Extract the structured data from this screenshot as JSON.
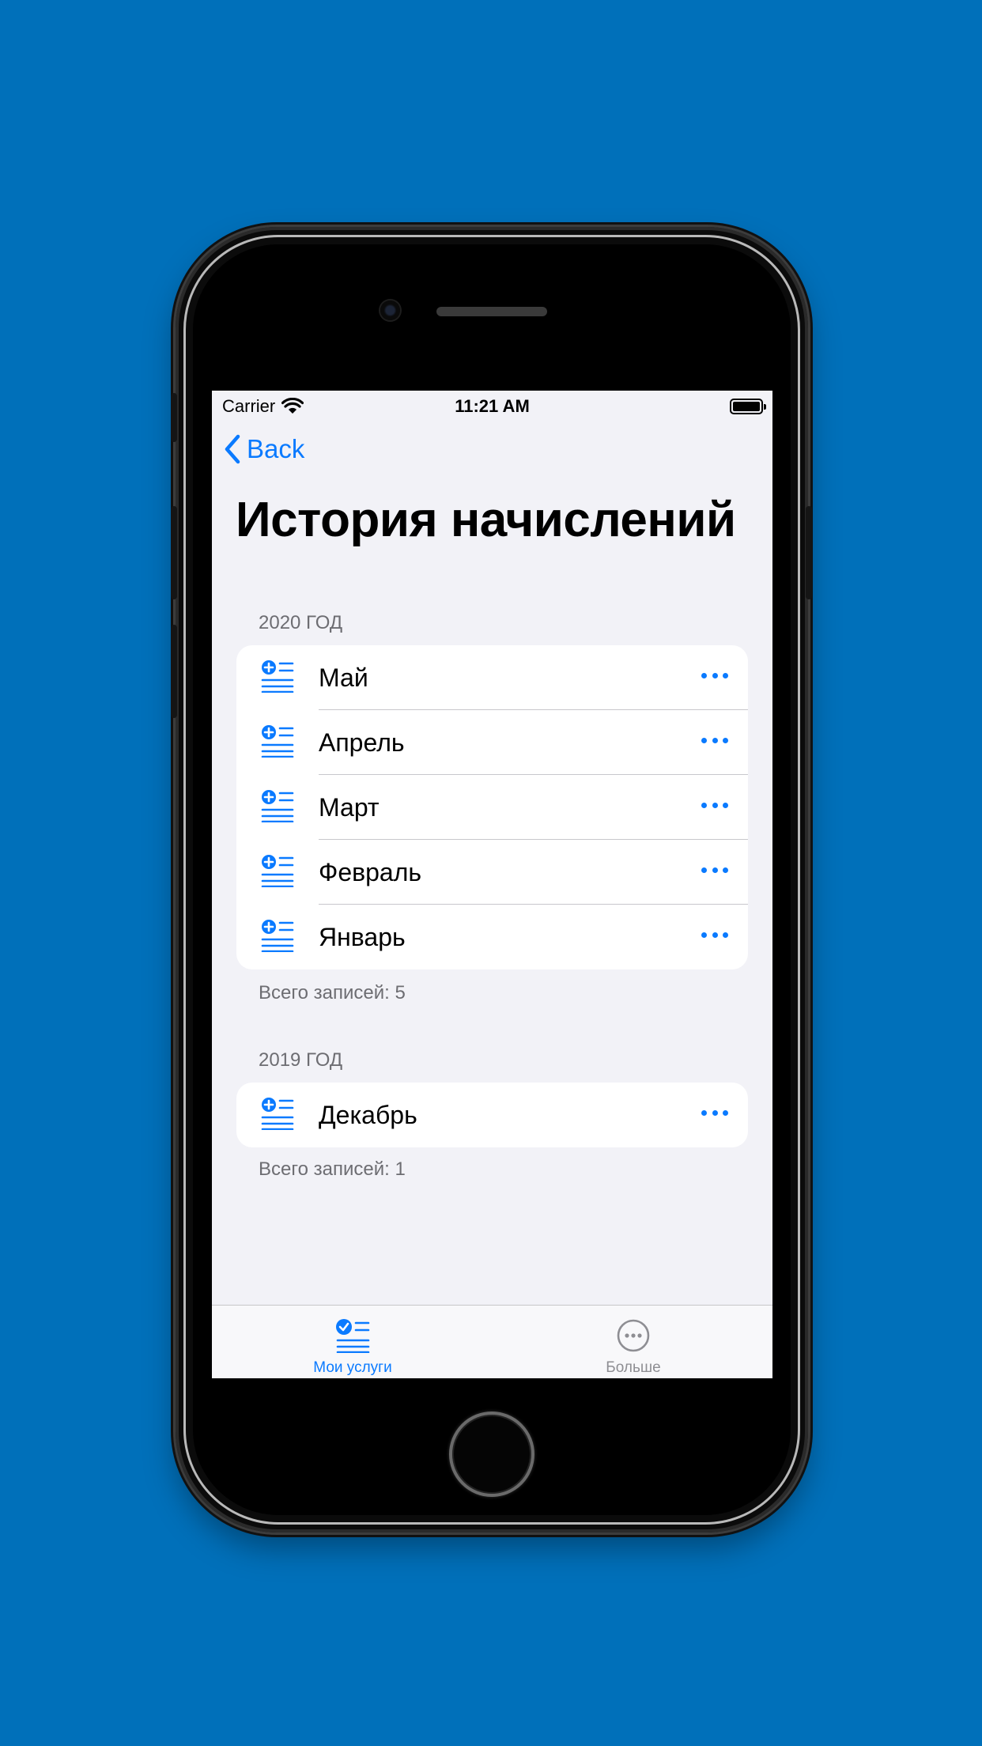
{
  "colors": {
    "background": "#0070BA",
    "accent": "#0A7AFF",
    "screen_bg": "#F2F2F7",
    "secondary_text": "#6D6D72",
    "tab_inactive": "#8E8E93"
  },
  "status_bar": {
    "carrier": "Carrier",
    "time": "11:21 AM",
    "wifi_icon": "wifi-icon",
    "battery_icon": "battery-icon"
  },
  "nav": {
    "back_label": "Back",
    "back_icon": "chevron-left-icon",
    "title": "История начислений"
  },
  "sections": [
    {
      "header": "2020 ГОД",
      "rows": [
        {
          "label": "Май"
        },
        {
          "label": "Апрель"
        },
        {
          "label": "Март"
        },
        {
          "label": "Февраль"
        },
        {
          "label": "Январь"
        }
      ],
      "footer": "Всего записей: 5"
    },
    {
      "header": "2019 ГОД",
      "rows": [
        {
          "label": "Декабрь"
        }
      ],
      "footer": "Всего записей: 1"
    }
  ],
  "row_icon": "add-list-icon",
  "row_action_icon": "ellipsis-icon",
  "tab_bar": {
    "tabs": [
      {
        "label": "Мои услуги",
        "icon": "checklist-icon",
        "selected": true
      },
      {
        "label": "Больше",
        "icon": "more-circle-icon",
        "selected": false
      }
    ]
  }
}
